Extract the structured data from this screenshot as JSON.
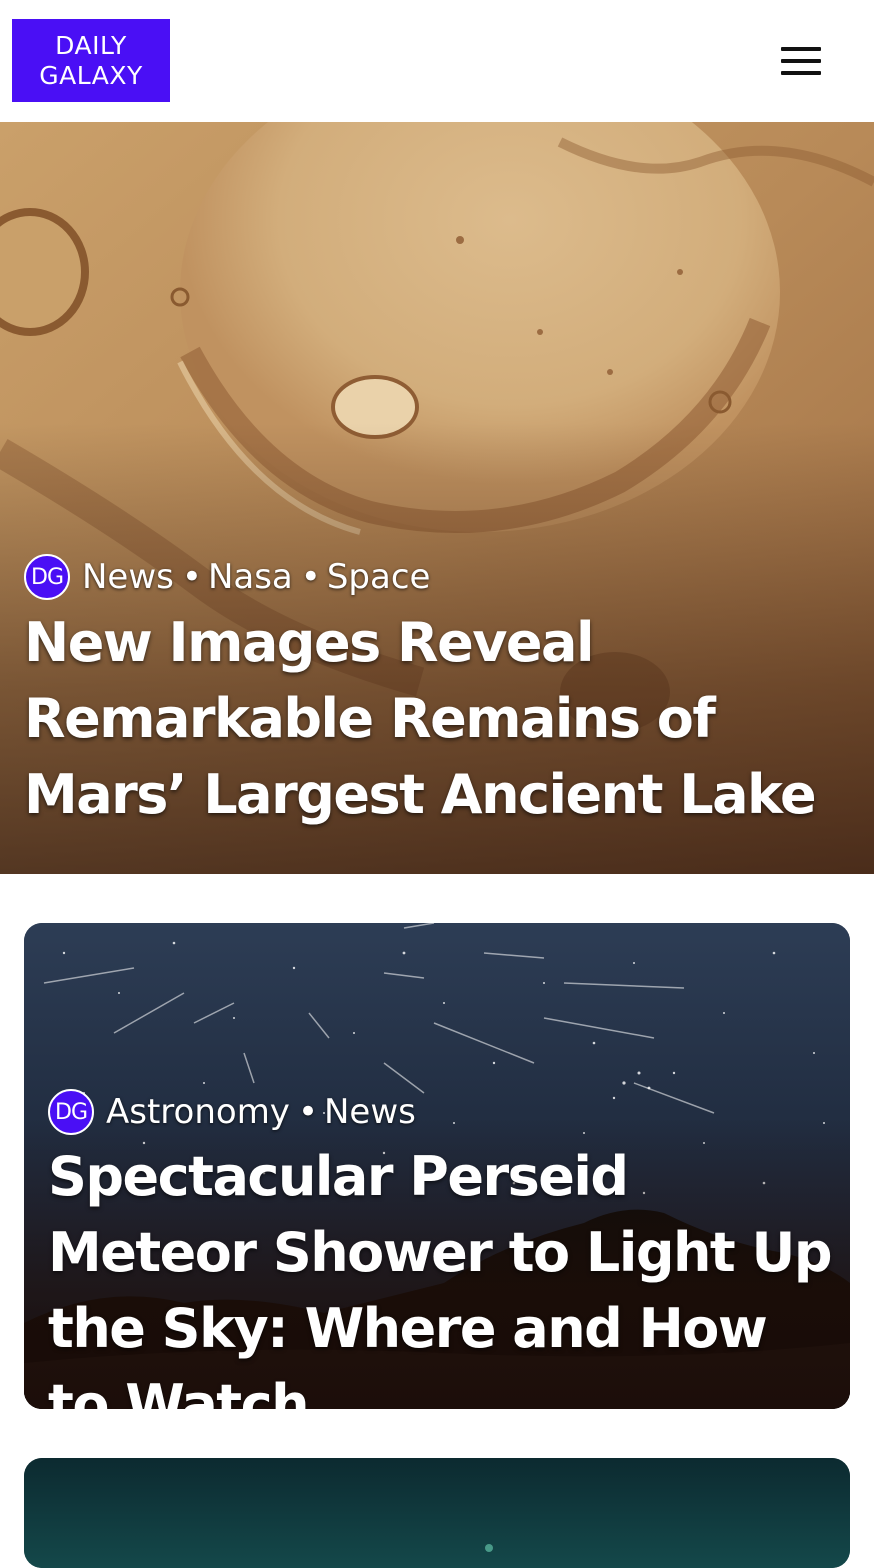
{
  "header": {
    "logo_line1": "DAILY",
    "logo_line2": "GALAXY",
    "logo_color": "#4a0ff5",
    "menu_icon": "hamburger-menu-icon"
  },
  "hero": {
    "badge": "DG",
    "categories": [
      "News",
      "Nasa",
      "Space"
    ],
    "separator": "•",
    "title": "New Images Reveal Remarkable Remains of Mars’ Largest Ancient Lake"
  },
  "cards": [
    {
      "badge": "DG",
      "categories": [
        "Astronomy",
        "News"
      ],
      "separator": "•",
      "title": "Spectacular Perseid Meteor Shower to Light Up the Sky: Where and How to Watch"
    }
  ]
}
